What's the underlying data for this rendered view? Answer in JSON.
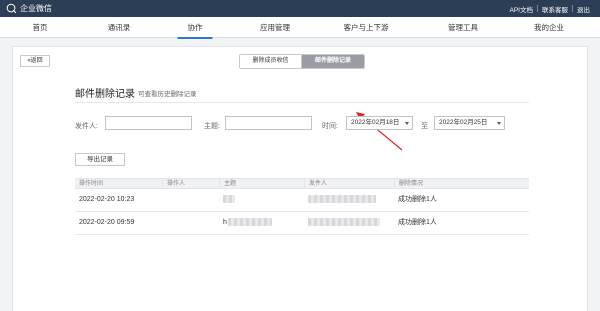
{
  "topbar": {
    "brand": "企业微信",
    "links": [
      "API文档",
      "联系客服",
      "退出"
    ]
  },
  "nav": {
    "items": [
      {
        "label": "首页",
        "active": false
      },
      {
        "label": "通讯录",
        "active": false
      },
      {
        "label": "协作",
        "active": true
      },
      {
        "label": "应用管理",
        "active": false
      },
      {
        "label": "客户与上下游",
        "active": false
      },
      {
        "label": "管理工具",
        "active": false
      },
      {
        "label": "我的企业",
        "active": false
      }
    ]
  },
  "page": {
    "back_label": "«返回",
    "tabs": [
      {
        "label": "删除成员收信",
        "active": false
      },
      {
        "label": "邮件删除记录",
        "active": true
      }
    ],
    "title": "邮件删除记录",
    "subtitle": "可查看历史删除记录"
  },
  "filters": {
    "sender_label": "发件人:",
    "sender_value": "",
    "subject_label": "主题:",
    "subject_value": "",
    "time_label": "时间:",
    "start_date": "2022年02月18日",
    "to_label": "至",
    "end_date": "2022年02月25日"
  },
  "export_label": "导出记录",
  "table": {
    "columns": [
      "操作时间",
      "操作人",
      "主题",
      "发件人",
      "删除情况"
    ],
    "rows": [
      {
        "time": "2022-02-20 10:23",
        "subject_prefix": "",
        "status": "成功删除1人"
      },
      {
        "time": "2022-02-20 09:59",
        "subject_prefix": "h",
        "status": "成功删除1人"
      }
    ]
  },
  "colors": {
    "topbar": "#2c3e56",
    "accent": "#2e77d0",
    "annotation": "#e0262b"
  }
}
